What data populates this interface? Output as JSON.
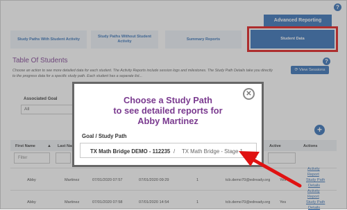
{
  "header": {
    "advanced_reporting": "Advanced Reporting"
  },
  "tabs": [
    {
      "label": "Study Paths With Student Activity"
    },
    {
      "label": "Study Paths Without Student Activity"
    },
    {
      "label": "Summary Reports"
    },
    {
      "label": "Student Data"
    }
  ],
  "main": {
    "title": "Table Of Students",
    "description": "Choose an action to see more detailed data for each student. The Activity Reports include session logs and milestones. The Study Path Details take you directly to the progress data for a specific study path. Each student has a separate list...",
    "view_sessions": "View Sessions",
    "associated_goal_label": "Associated Goal",
    "associated_goal_value": "All"
  },
  "table": {
    "headers": [
      "First Name",
      "Last Name",
      "Active",
      "Actions"
    ],
    "filter_placeholder": "Filter",
    "rows": [
      {
        "first": "Abby",
        "last": "Martinez",
        "d1": "07/01/2020 07:57",
        "d2": "07/01/2020 09:29",
        "n": "1",
        "email": "tcb.demo70@edready.org",
        "active": "Yes",
        "a1": "Activity",
        "a2": "Report",
        "a3": "Study Path",
        "a4": "Details"
      },
      {
        "first": "Abby",
        "last": "Martinez",
        "d1": "07/01/2020 07:58",
        "d2": "07/01/2020 14:54",
        "n": "1",
        "email": "tcb.demo70@edready.org",
        "active": "Yes",
        "a1": "Activity",
        "a2": "Report",
        "a3": "Study Path",
        "a4": "Details"
      }
    ]
  },
  "modal": {
    "title_line1": "Choose a Study Path",
    "title_line2": "to see detailed reports for",
    "title_line3": "Abby Martinez",
    "column_label": "Goal / Study Path",
    "path_main": "TX Math Bridge DEMO - 112235",
    "path_separator": "/",
    "path_sub": "TX Math Bridge - Stage 1"
  },
  "colors": {
    "accent": "#2f6db5",
    "title": "#7a3a8f",
    "highlight": "#e01212"
  }
}
